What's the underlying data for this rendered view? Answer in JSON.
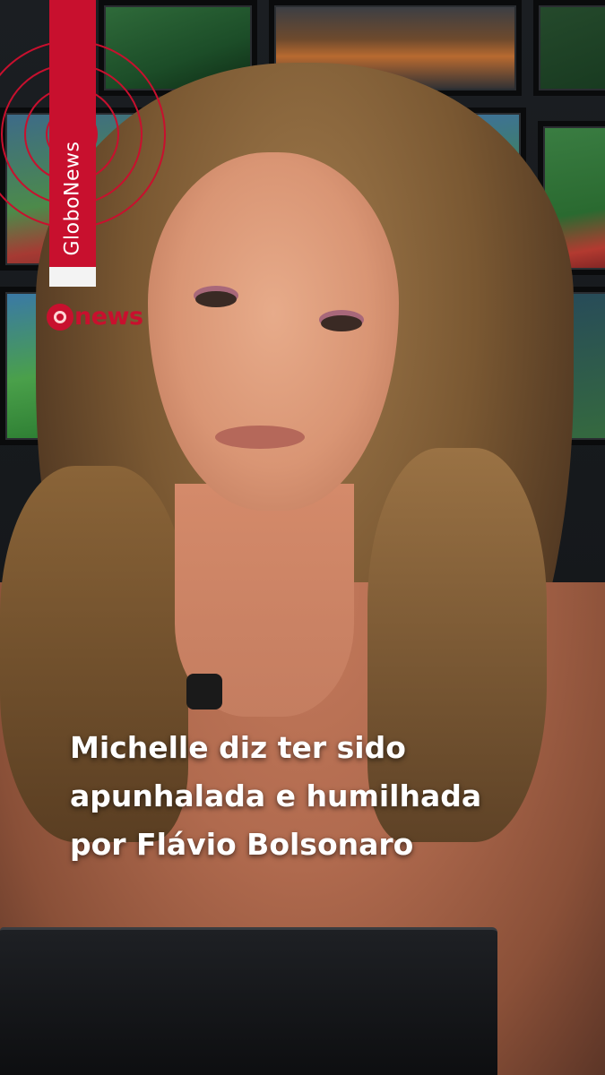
{
  "brand": {
    "vertical_label": "GloboNews",
    "logo_text": "news",
    "accent_color": "#c8102e"
  },
  "headline": {
    "lines": [
      "Michelle diz ter sido",
      "apunhalada e humilhada",
      "por Flávio Bolsonaro"
    ]
  },
  "icons": {
    "logo_mark": "globo-circle-icon",
    "decoration": "concentric-rings-icon"
  }
}
